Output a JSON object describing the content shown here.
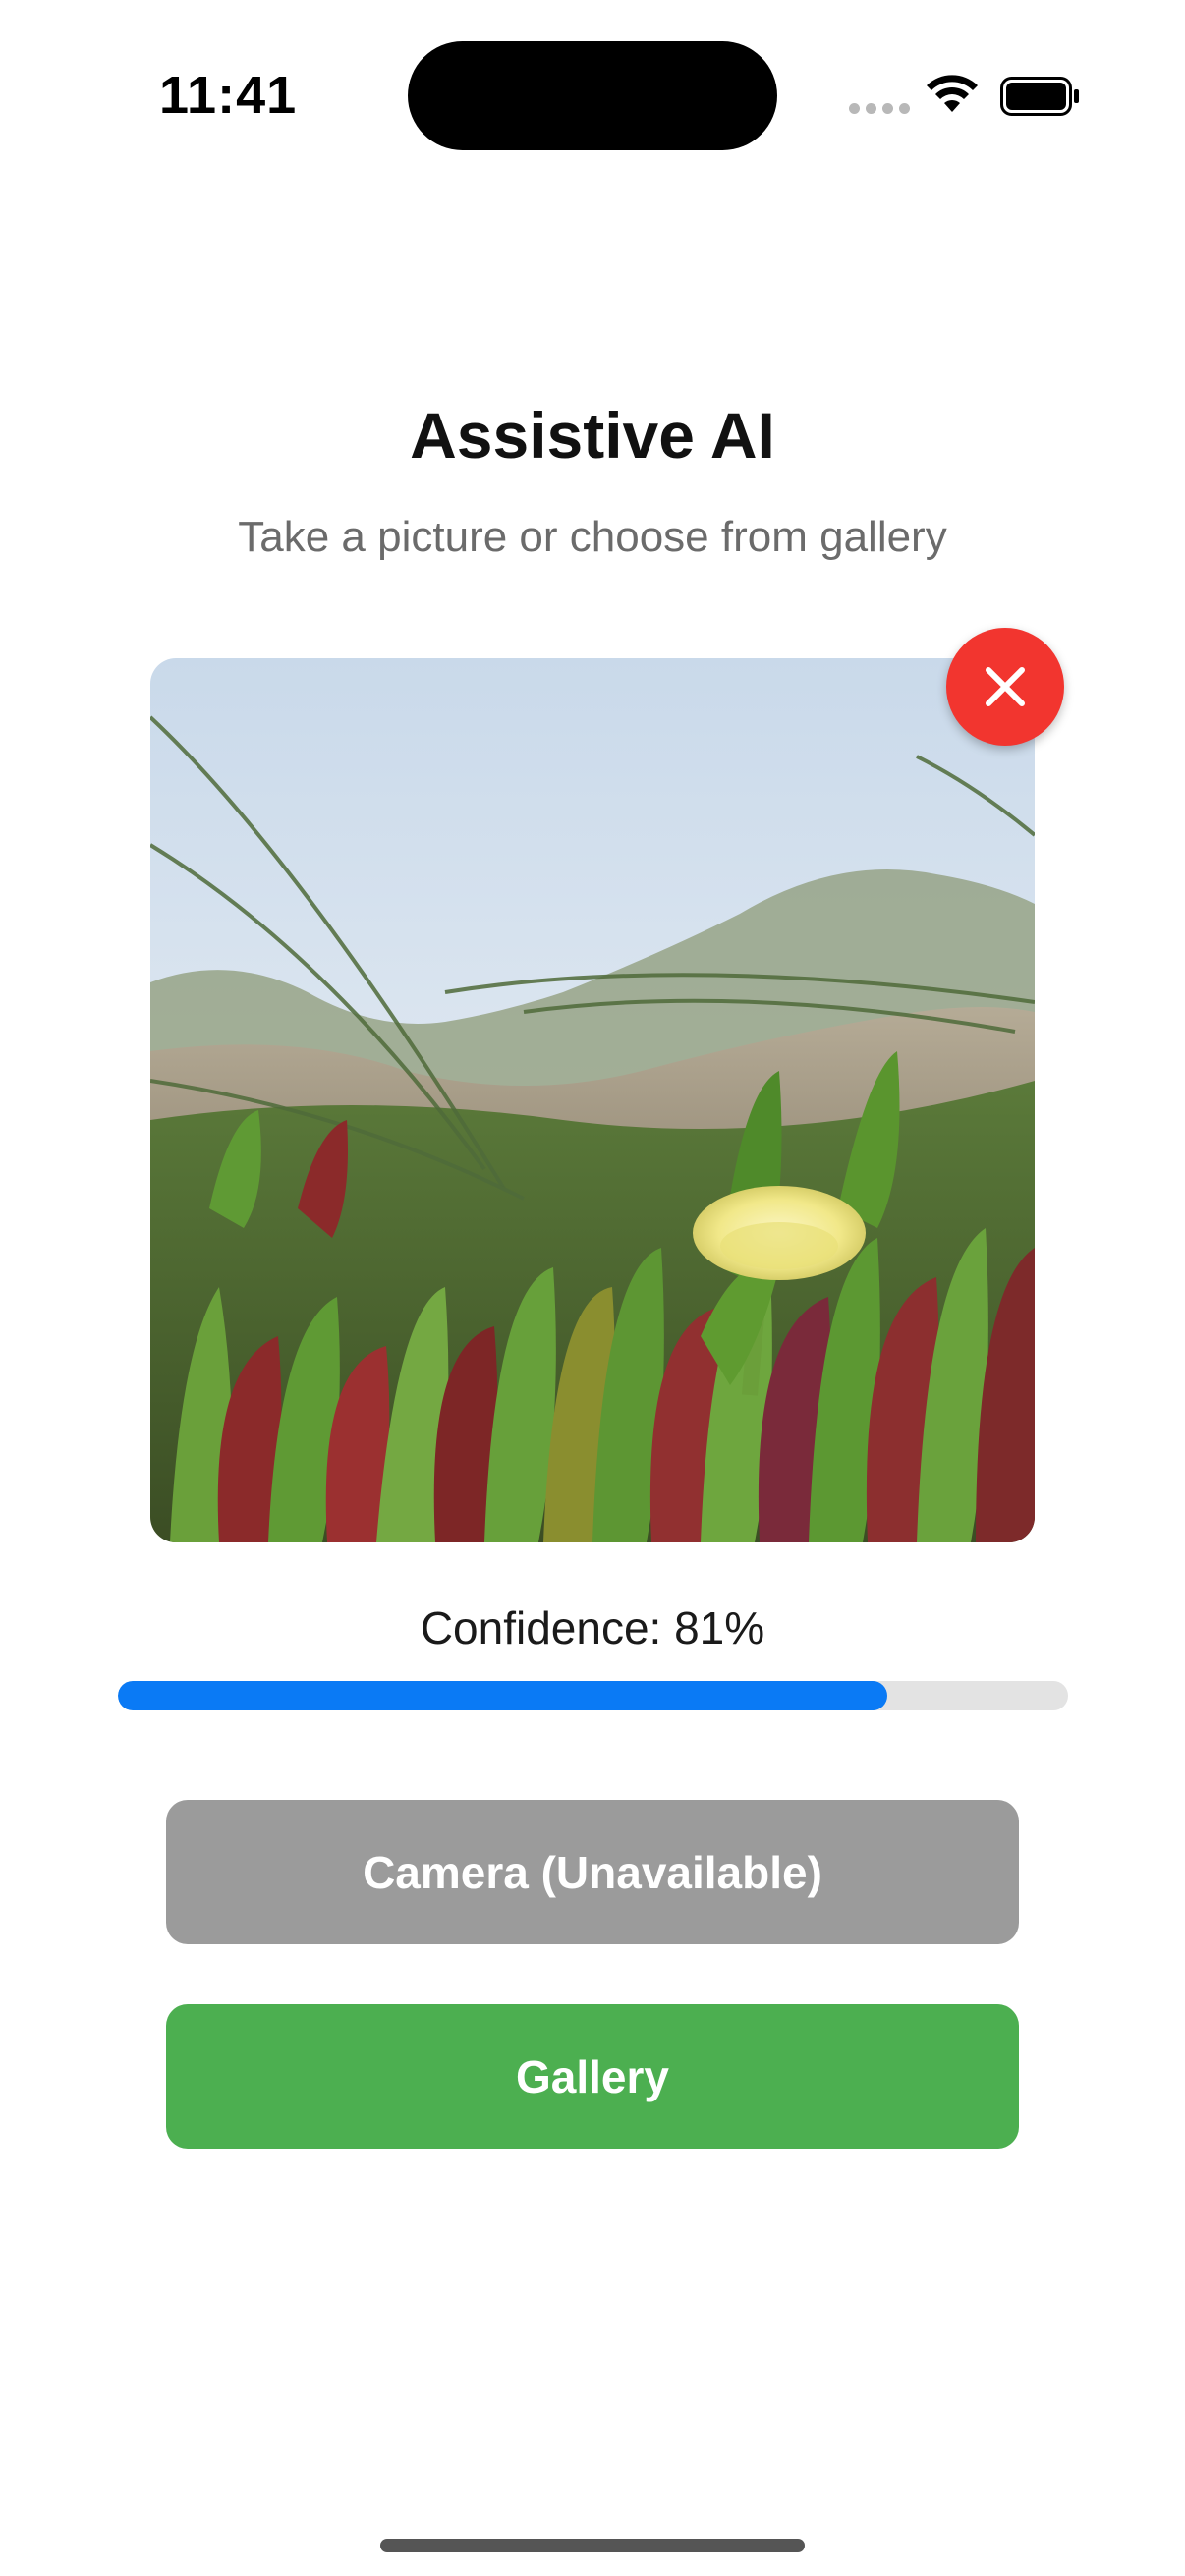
{
  "status_bar": {
    "time": "11:41"
  },
  "header": {
    "title": "Assistive AI",
    "subtitle": "Take a picture or choose from gallery"
  },
  "photo": {
    "subject": "yellow ice plant flower among green succulent leaves on sand dune"
  },
  "confidence": {
    "label": "Confidence: 81%",
    "value": 0.81
  },
  "buttons": {
    "camera_label": "Camera (Unavailable)",
    "gallery_label": "Gallery"
  },
  "icons": {
    "close": "close-icon",
    "wifi": "wifi-icon",
    "battery": "battery-icon"
  },
  "colors": {
    "close_button": "#f2352f",
    "progress_fill": "#0a7af5",
    "progress_track": "#e3e3e3",
    "camera_button_disabled": "#9b9b9b",
    "gallery_button": "#4caf50"
  }
}
